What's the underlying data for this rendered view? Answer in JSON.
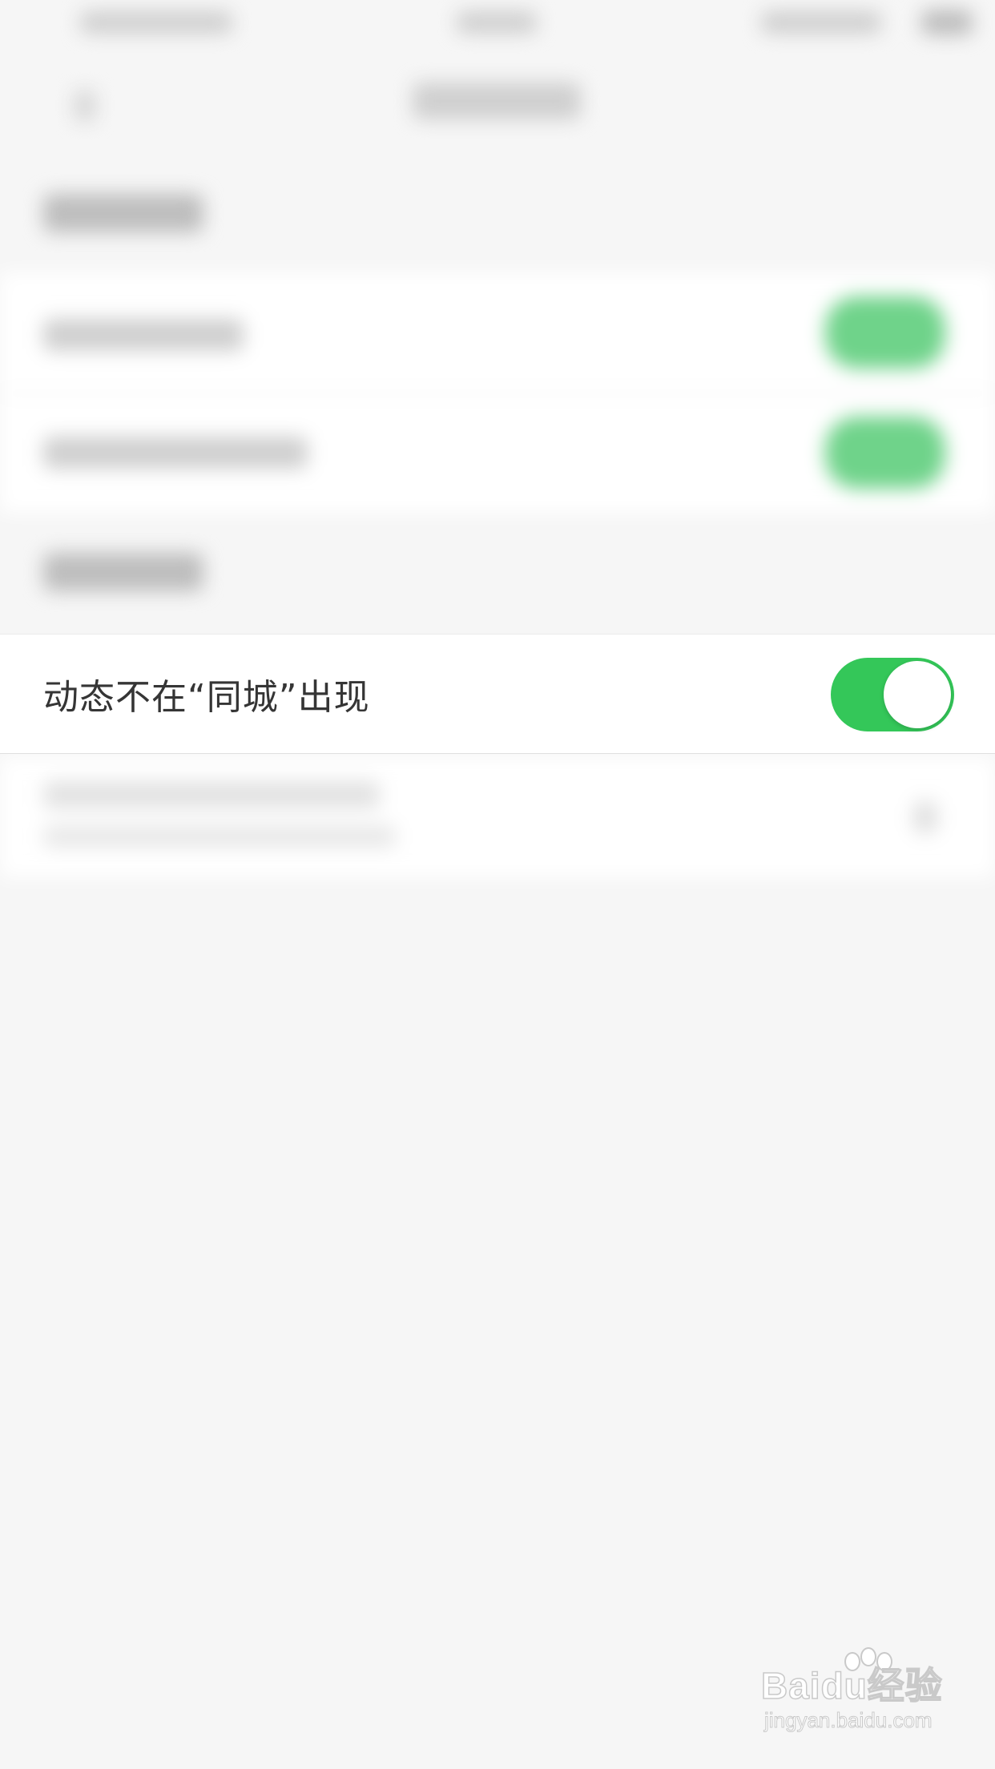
{
  "privacy_item": {
    "label": "动态不在“同城”出现",
    "toggle_on": true,
    "toggle_color": "#34c759"
  },
  "watermark": {
    "logo_text": "Baidu经验",
    "url_text": "jingyan.baidu.com"
  }
}
